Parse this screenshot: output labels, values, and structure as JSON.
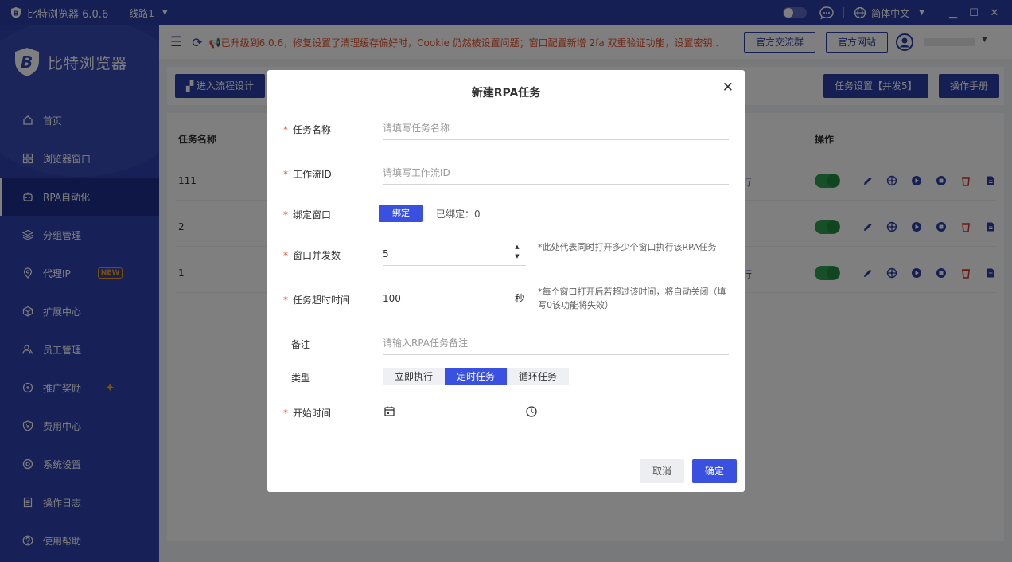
{
  "colors": {
    "brand": "#2d3fa8",
    "accent": "#3a50e0",
    "danger": "#e6502b",
    "success": "#2e9e52"
  },
  "titlebar": {
    "app_title": "比特浏览器 6.0.6",
    "route": "线路1",
    "language": "简体中文"
  },
  "sidebar": {
    "brand_name": "比特浏览器",
    "items": [
      {
        "label": "首页",
        "icon": "home-icon"
      },
      {
        "label": "浏览器窗口",
        "icon": "grid-icon"
      },
      {
        "label": "RPA自动化",
        "icon": "robot-icon",
        "active": true
      },
      {
        "label": "分组管理",
        "icon": "layers-icon"
      },
      {
        "label": "代理IP",
        "icon": "location-icon",
        "badge": "NEW"
      },
      {
        "label": "扩展中心",
        "icon": "cube-icon"
      },
      {
        "label": "员工管理",
        "icon": "users-icon"
      },
      {
        "label": "推广奖励",
        "icon": "reward-icon"
      },
      {
        "label": "费用中心",
        "icon": "shield-yen-icon"
      },
      {
        "label": "系统设置",
        "icon": "settings-icon"
      },
      {
        "label": "操作日志",
        "icon": "log-icon"
      },
      {
        "label": "使用帮助",
        "icon": "help-icon"
      }
    ]
  },
  "infobar": {
    "notice": "📢已升级到6.0.6，修复设置了清理缓存偏好时，Cookie 仍然被设置问题；窗口配置新增 2fa 双重验证功能，设置密钥...",
    "community_label": "官方交流群",
    "website_label": "官方网站"
  },
  "toolbar": {
    "flow_design_label": "进入流程设计",
    "task_settings_label": "任务设置【并发5】",
    "manual_label": "操作手册"
  },
  "table": {
    "headers": {
      "name": "任务名称",
      "actions": "操作"
    },
    "rows": [
      {
        "name": "111",
        "status": "行",
        "enabled": true
      },
      {
        "name": "2",
        "status": "",
        "enabled": true
      },
      {
        "name": "1",
        "status": "行",
        "enabled": true
      }
    ]
  },
  "modal": {
    "title": "新建RPA任务",
    "fields": {
      "task_name": {
        "label": "任务名称",
        "placeholder": "请填写任务名称"
      },
      "workflow_id": {
        "label": "工作流ID",
        "placeholder": "请填写工作流ID"
      },
      "bind_window": {
        "label": "绑定窗口",
        "button": "绑定",
        "bound": "已绑定：0"
      },
      "concurrency": {
        "label": "窗口并发数",
        "value": "5",
        "hint": "*此处代表同时打开多少个窗口执行该RPA任务"
      },
      "timeout": {
        "label": "任务超时时间",
        "value": "100",
        "unit": "秒",
        "hint": "*每个窗口打开后若超过该时间，将自动关闭（填写0该功能将失效）"
      },
      "remark": {
        "label": "备注",
        "placeholder": "请输入RPA任务备注"
      },
      "type": {
        "label": "类型",
        "options": [
          "立即执行",
          "定时任务",
          "循环任务"
        ],
        "selected": "定时任务"
      },
      "start_time": {
        "label": "开始时间"
      }
    },
    "cancel_label": "取消",
    "ok_label": "确定"
  }
}
